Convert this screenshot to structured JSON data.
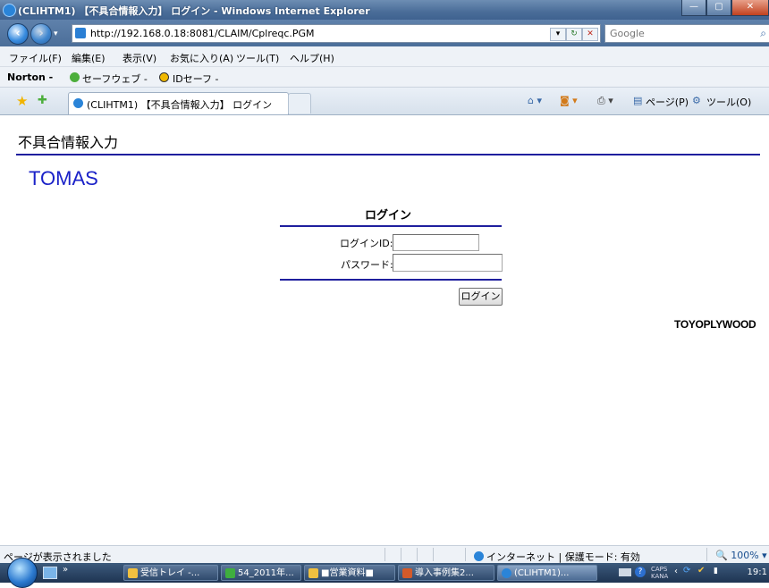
{
  "window": {
    "title": "(CLIHTM1) 【不具合情報入力】 ログイン - Windows Internet Explorer",
    "minimize": "—",
    "maximize": "▢",
    "close": "✕"
  },
  "address_bar": {
    "url": "http://192.168.0.18:8081/CLAIM/Cplreqc.PGM",
    "search_placeholder": "Google"
  },
  "menu": [
    "ファイル(F)",
    "編集(E)",
    "表示(V)",
    "お気に入り(A)",
    "ツール(T)",
    "ヘルプ(H)"
  ],
  "norton": {
    "brand": "Norton -",
    "safe_web": "セーフウェブ -",
    "id_safe": "IDセーフ -"
  },
  "tab": {
    "label": "(CLIHTM1) 【不具合情報入力】 ログイン"
  },
  "command_bar": {
    "page": "ページ(P)",
    "tools": "ツール(O)"
  },
  "page": {
    "heading": "不具合情報入力",
    "brand": "TOMAS",
    "login_title": "ログイン",
    "login_id_label": "ログインID:",
    "password_label": "パスワード:",
    "login_button": "ログイン",
    "company": "TOYOPLYWOOD"
  },
  "status_bar": {
    "text": "ページが表示されました",
    "zone": "インターネット | 保護モード: 有効",
    "zoom": "100%"
  },
  "taskbar": {
    "items": [
      "受信トレイ -...",
      "54_2011年...",
      "■営業資料■",
      "導入事例集2...",
      "(CLIHTM1)..."
    ],
    "clock": "19:1"
  }
}
